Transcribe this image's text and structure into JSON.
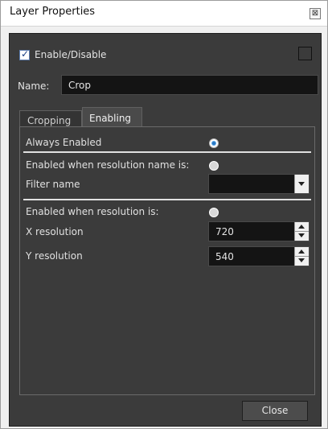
{
  "window": {
    "title": "Layer Properties",
    "close_glyph": "⊠"
  },
  "enable": {
    "label": "Enable/Disable",
    "checked": true
  },
  "name": {
    "label": "Name:",
    "value": "Crop"
  },
  "tabs": [
    {
      "label": "Cropping",
      "active": false
    },
    {
      "label": "Enabling",
      "active": true
    }
  ],
  "enabling": {
    "always_enabled": {
      "label": "Always Enabled",
      "selected": true
    },
    "by_name": {
      "label": "Enabled when resolution name is:",
      "selected": false
    },
    "filter_name": {
      "label": "Filter name",
      "value": ""
    },
    "by_resolution": {
      "label": "Enabled when resolution is:",
      "selected": false
    },
    "x_resolution": {
      "label": "X resolution",
      "value": "720"
    },
    "y_resolution": {
      "label": "Y resolution",
      "value": "540"
    }
  },
  "footer": {
    "close_label": "Close"
  },
  "icons": {
    "checkbox": "checkbox-checked-icon",
    "radio_on": "radio-selected-icon",
    "radio_off": "radio-unselected-icon",
    "dropdown": "chevron-down-icon",
    "spinner": "spinner-arrows-icon"
  },
  "colors": {
    "panel_bg": "#3b3b3b",
    "field_bg": "#141414",
    "accent": "#2a78c4"
  }
}
